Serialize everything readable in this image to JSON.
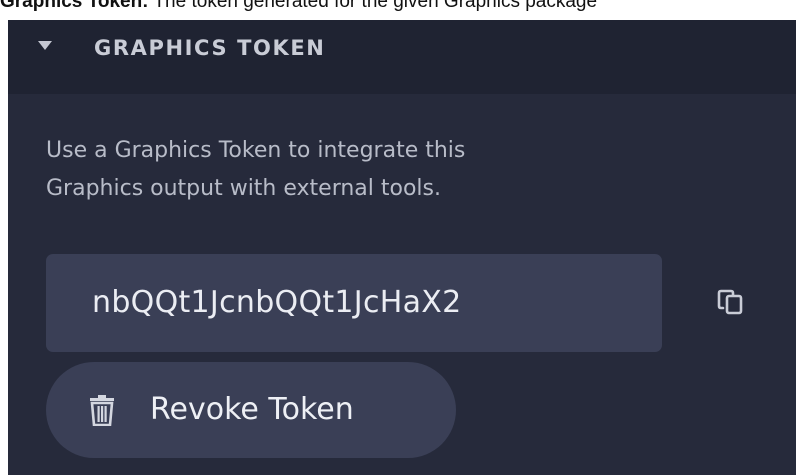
{
  "caption": {
    "lead": "Graphics Token:",
    "text": "The token generated for the given Graphics package"
  },
  "panel": {
    "header": {
      "title": "GRAPHICS TOKEN",
      "caret_icon": "caret-down-icon"
    },
    "description": {
      "line1": "Use a Graphics Token to integrate this",
      "line2": "Graphics output with external tools."
    },
    "token": {
      "value": "nbQQt1JcnbQQt1JcHaX2",
      "copy_icon": "copy-icon"
    },
    "revoke_button": {
      "label": "Revoke Token",
      "icon": "trash-icon"
    }
  },
  "colors": {
    "panel_bg": "#262a3b",
    "header_bg": "#1f2332",
    "field_bg": "#3a3f56",
    "text_primary": "#ebedf3",
    "text_muted": "#b8bcc8"
  }
}
